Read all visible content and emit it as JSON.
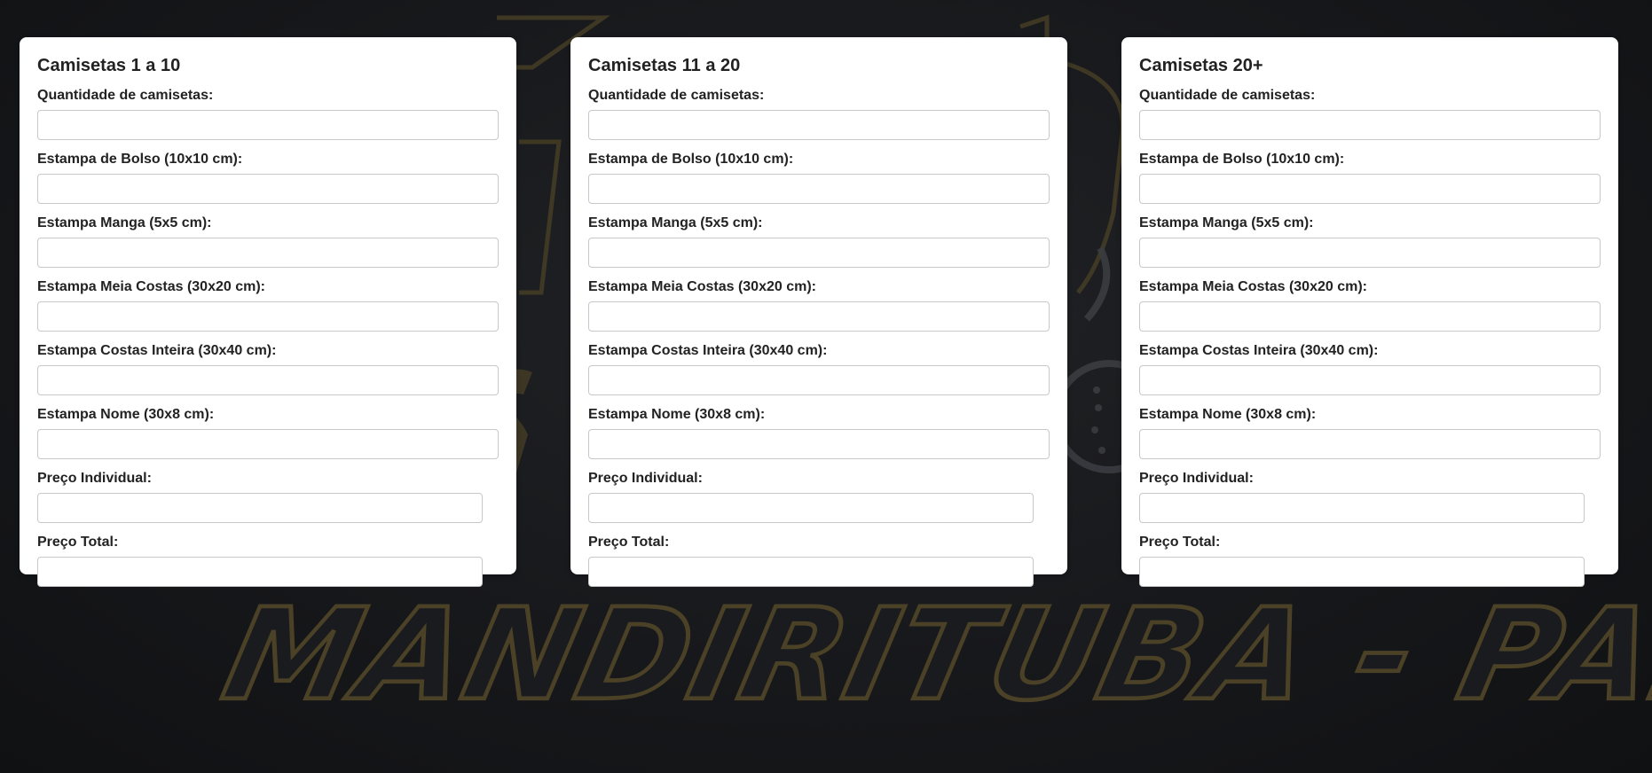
{
  "background": {
    "banner_text": "MANDIRITUBA - PARANÁ",
    "accent_color": "#4b4126",
    "page_color": "#17181b"
  },
  "cards": [
    {
      "title": "Camisetas 1 a 10",
      "fields": [
        {
          "label": "Quantidade de camisetas:",
          "value": "",
          "placeholder": ""
        },
        {
          "label": "Estampa de Bolso (10x10 cm):",
          "value": "",
          "placeholder": ""
        },
        {
          "label": "Estampa Manga (5x5 cm):",
          "value": "",
          "placeholder": ""
        },
        {
          "label": "Estampa Meia Costas (30x20 cm):",
          "value": "",
          "placeholder": ""
        },
        {
          "label": "Estampa Costas Inteira (30x40 cm):",
          "value": "",
          "placeholder": ""
        },
        {
          "label": "Estampa Nome (30x8 cm):",
          "value": "",
          "placeholder": ""
        },
        {
          "label": "Preço Individual:",
          "value": "",
          "placeholder": ""
        },
        {
          "label": "Preço Total:",
          "value": "",
          "placeholder": ""
        }
      ]
    },
    {
      "title": "Camisetas 11 a 20",
      "fields": [
        {
          "label": "Quantidade de camisetas:",
          "value": "",
          "placeholder": ""
        },
        {
          "label": "Estampa de Bolso (10x10 cm):",
          "value": "",
          "placeholder": ""
        },
        {
          "label": "Estampa Manga (5x5 cm):",
          "value": "",
          "placeholder": ""
        },
        {
          "label": "Estampa Meia Costas (30x20 cm):",
          "value": "",
          "placeholder": ""
        },
        {
          "label": "Estampa Costas Inteira (30x40 cm):",
          "value": "",
          "placeholder": ""
        },
        {
          "label": "Estampa Nome (30x8 cm):",
          "value": "",
          "placeholder": ""
        },
        {
          "label": "Preço Individual:",
          "value": "",
          "placeholder": ""
        },
        {
          "label": "Preço Total:",
          "value": "",
          "placeholder": ""
        }
      ]
    },
    {
      "title": "Camisetas 20+",
      "fields": [
        {
          "label": "Quantidade de camisetas:",
          "value": "",
          "placeholder": ""
        },
        {
          "label": "Estampa de Bolso (10x10 cm):",
          "value": "",
          "placeholder": ""
        },
        {
          "label": "Estampa Manga (5x5 cm):",
          "value": "",
          "placeholder": ""
        },
        {
          "label": "Estampa Meia Costas (30x20 cm):",
          "value": "",
          "placeholder": ""
        },
        {
          "label": "Estampa Costas Inteira (30x40 cm):",
          "value": "",
          "placeholder": ""
        },
        {
          "label": "Estampa Nome (30x8 cm):",
          "value": "",
          "placeholder": ""
        },
        {
          "label": "Preço Individual:",
          "value": "",
          "placeholder": ""
        },
        {
          "label": "Preço Total:",
          "value": "",
          "placeholder": ""
        }
      ]
    }
  ]
}
